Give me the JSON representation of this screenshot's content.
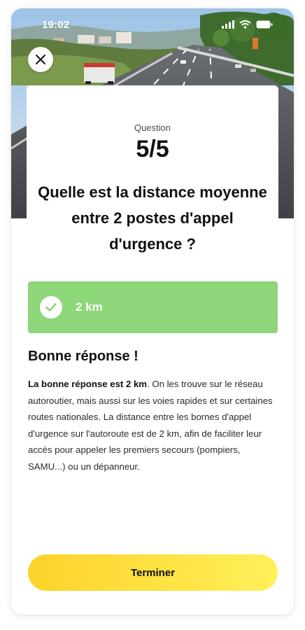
{
  "status_bar": {
    "time": "19:02",
    "icons": [
      "signal-icon",
      "wifi-icon",
      "battery-icon"
    ]
  },
  "header": {
    "background_image": "highway-photo",
    "close_icon": "close-icon"
  },
  "question": {
    "label": "Question",
    "counter": "5/5",
    "text": "Quelle est la distance moyenne entre 2 postes d'appel d'urgence ?"
  },
  "answer": {
    "label": "2 km",
    "icon": "check-icon",
    "status": "correct"
  },
  "feedback": {
    "title": "Bonne réponse !",
    "highlight": "La bonne réponse est 2 km",
    "body": ". On les trouve sur le réseau autoroutier, mais aussi sur les voies rapides et sur certaines routes nationales. La distance entre les bornes d'appel d'urgence sur l'autoroute est de 2 km, afin de faciliter leur accès pour appeler les premiers secours (pompiers, SAMU...) ou un dépanneur."
  },
  "actions": {
    "finish_label": "Terminer"
  },
  "colors": {
    "correct_green": "#8ed67a",
    "button_yellow_start": "#fdd22a",
    "button_yellow_end": "#fff05a",
    "text_dark": "#111111"
  }
}
